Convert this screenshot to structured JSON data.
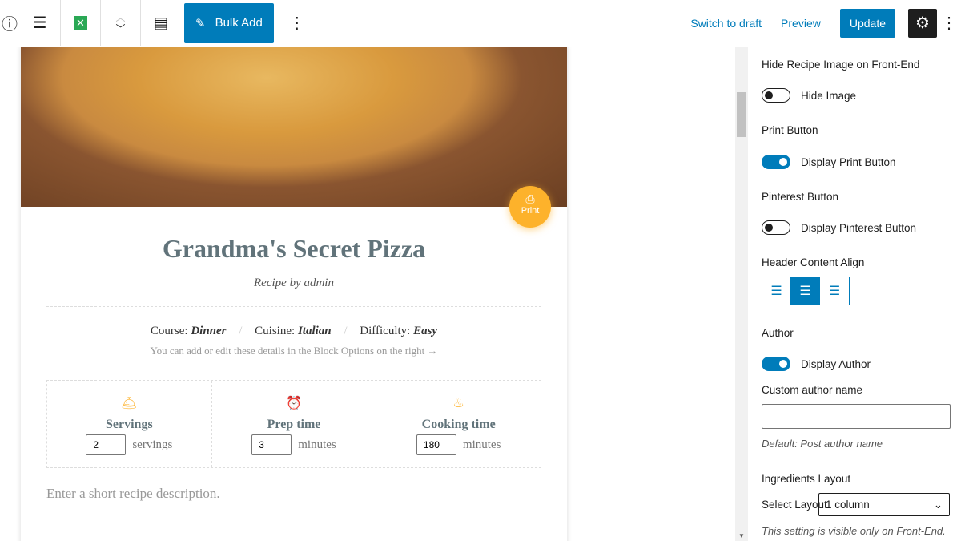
{
  "toolbar": {
    "bulk_add": "Bulk Add",
    "switch_draft": "Switch to draft",
    "preview": "Preview",
    "update": "Update"
  },
  "recipe": {
    "print": "Print",
    "title": "Grandma's Secret Pizza",
    "byline": "Recipe by admin",
    "course_label": "Course:",
    "course": "Dinner",
    "cuisine_label": "Cuisine:",
    "cuisine": "Italian",
    "difficulty_label": "Difficulty:",
    "difficulty": "Easy",
    "hint": "You can add or edit these details in the Block Options on the right →",
    "details": [
      {
        "label": "Servings",
        "value": "2",
        "unit": "servings"
      },
      {
        "label": "Prep time",
        "value": "3",
        "unit": "minutes"
      },
      {
        "label": "Cooking time",
        "value": "180",
        "unit": "minutes"
      }
    ],
    "description_placeholder": "Enter a short recipe description."
  },
  "sidebar": {
    "hide_image_title": "Hide Recipe Image on Front-End",
    "hide_image": "Hide Image",
    "hide_image_on": false,
    "print_title": "Print Button",
    "print_toggle": "Display Print Button",
    "print_on": true,
    "pinterest_title": "Pinterest Button",
    "pinterest_toggle": "Display Pinterest Button",
    "pinterest_on": false,
    "align_title": "Header Content Align",
    "align_selected": "center",
    "author_title": "Author",
    "author_toggle": "Display Author",
    "author_on": true,
    "custom_author_label": "Custom author name",
    "custom_author_value": "",
    "custom_author_help": "Default: Post author name",
    "ingredients_title": "Ingredients Layout",
    "select_layout_label": "Select Layout",
    "select_layout_value": "1 column",
    "layout_help": "This setting is visible only on Front-End."
  }
}
